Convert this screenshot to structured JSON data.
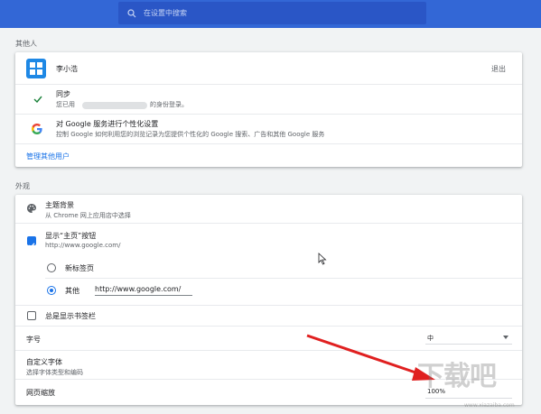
{
  "search": {
    "placeholder": "在设置中搜索"
  },
  "others": {
    "section_title": "其他人",
    "user_name": "李小浩",
    "signout_label": "退出",
    "sync_title": "同步",
    "sync_desc_prefix": "您已用",
    "sync_desc_suffix": "的身份登录。",
    "personalize_title": "对 Google 服务进行个性化设置",
    "personalize_desc": "控制 Google 如何利用您的浏览记录为您提供个性化的 Google 搜索、广告和其他 Google 服务",
    "manage_label": "管理其他用户"
  },
  "appearance": {
    "section_title": "外观",
    "theme_title": "主题背景",
    "theme_desc": "从 Chrome 网上应用店中选择",
    "home_title": "显示“主页”按钮",
    "home_url": "http://www.google.com/",
    "radio_newtab": "新标签页",
    "radio_other": "其他",
    "other_url": "http://www.google.com/",
    "show_home_checked": true,
    "bookmarks_label": "总是显示书签栏",
    "bookmarks_checked": false,
    "font_size_label": "字号",
    "font_size_value": "中",
    "custom_fonts_title": "自定义字体",
    "custom_fonts_desc": "选择字体类型和编码",
    "zoom_label": "网页缩放",
    "zoom_value": "100%"
  },
  "watermark": {
    "logo_text": "下载吧",
    "url_text": "www.xiazaiba.com"
  },
  "colors": {
    "topbar": "#3367d6",
    "accent": "#1a73e8",
    "arrow": "#e02020"
  }
}
